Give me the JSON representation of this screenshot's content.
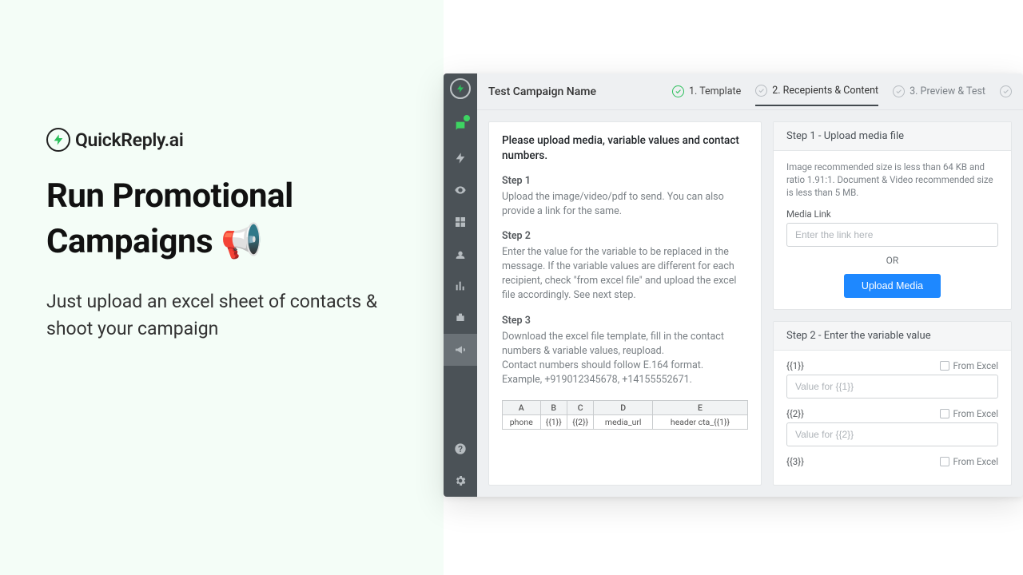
{
  "promo": {
    "brand": "QuickReply.ai",
    "title": "Run Promotional Campaigns 📢",
    "subtitle": "Just upload an excel sheet of contacts & shoot your campaign"
  },
  "topbar": {
    "campaign_name": "Test Campaign Name",
    "step1": "1. Template",
    "step2": "2. Recepients & Content",
    "step3": "3. Preview & Test"
  },
  "instructions": {
    "intro": "Please upload media, variable values and contact numbers.",
    "s1_h": "Step 1",
    "s1_p": "Upload the image/video/pdf to send. You can also provide a link for the same.",
    "s2_h": "Step 2",
    "s2_p": "Enter the value for the variable to be replaced in the message. If the variable values are different for each recipient, check \"from excel file\" and upload the excel file accordingly. See next step.",
    "s3_h": "Step 3",
    "s3_p1": "Download the excel file template, fill in the contact numbers & variable values, reupload.",
    "s3_p2": "Contact numbers should follow E.164 format.",
    "s3_p3": "Example, +919012345678, +14155552671.",
    "table_headers": [
      "A",
      "B",
      "C",
      "D",
      "E"
    ],
    "table_row": [
      "phone",
      "{{1}}",
      "{{2}}",
      "media_url",
      "header cta_{{1}}"
    ]
  },
  "upload": {
    "title": "Step 1 - Upload media file",
    "hint": "Image recommended size is less than 64 KB and ratio 1.91:1. Document & Video recommended size is less than 5 MB.",
    "link_label": "Media Link",
    "link_placeholder": "Enter the link here",
    "or": "OR",
    "button": "Upload Media"
  },
  "vars": {
    "title": "Step 2 -  Enter the variable value",
    "from_excel": "From Excel",
    "items": [
      {
        "name": "{{1}}",
        "placeholder": "Value for {{1}}"
      },
      {
        "name": "{{2}}",
        "placeholder": "Value for {{2}}"
      },
      {
        "name": "{{3}}",
        "placeholder": ""
      }
    ]
  }
}
